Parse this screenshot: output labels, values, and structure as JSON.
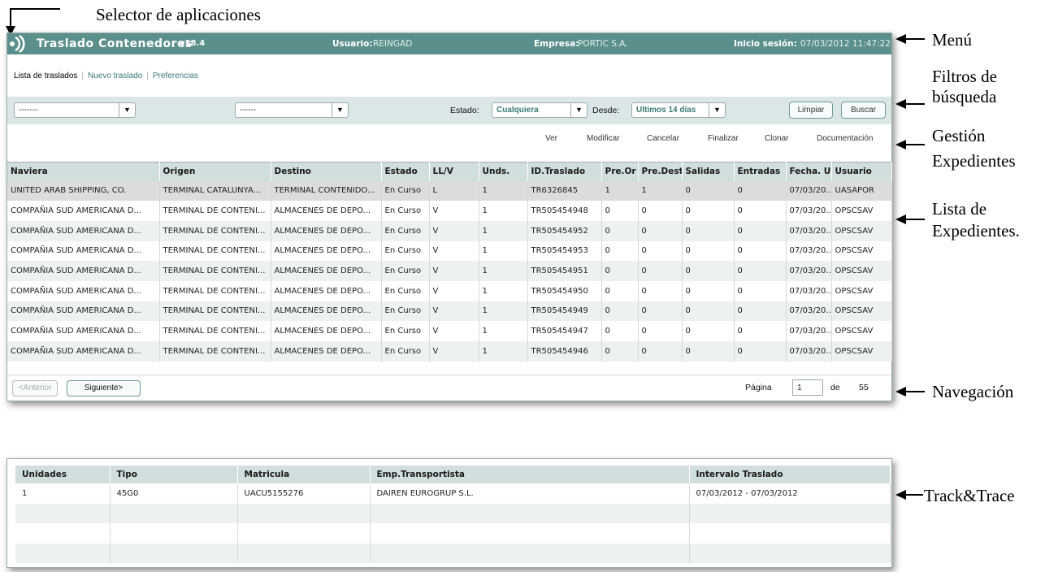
{
  "annotations": {
    "selector": "Selector de aplicaciones",
    "menu": "Menú",
    "filters_1": "Filtros de",
    "filters_2": "búsqueda",
    "gestion_1": "Gestión",
    "gestion_2": "Expedientes",
    "lista_1": "Lista de",
    "lista_2": "Expedientes.",
    "navegacion": "Navegación",
    "track": "Track&Trace"
  },
  "menubar": {
    "app_title": "Traslado Contenedores",
    "version": "v18.4",
    "user_label": "Usuario:",
    "user_value": "REINGAD",
    "company_label": "Empresa:",
    "company_value": "PORTIC S.A.",
    "session_label": "Inicio sesión:",
    "session_value": "07/03/2012 11:47:22"
  },
  "nav_tabs": {
    "list": "Lista de traslados",
    "new": "Nuevo traslado",
    "prefs": "Preferencias"
  },
  "filters": {
    "select1": "-------",
    "select2": "------",
    "estado_label": "Estado:",
    "estado_value": "Cualquiera",
    "desde_label": "Desde:",
    "desde_value": "Últimos 14 días",
    "clear_label": "Limpiar",
    "search_label": "Buscar"
  },
  "actions": {
    "view": "Ver",
    "modify": "Modificar",
    "cancel": "Cancelar",
    "finish": "Finalizar",
    "clone": "Clonar",
    "docs": "Documentación"
  },
  "grid": {
    "columns": [
      "Naviera",
      "Origen",
      "Destino",
      "Estado",
      "LL/V",
      "Unds.",
      "ID.Traslado",
      "Pre.Or",
      "Pre.Dest.",
      "Salidas",
      "Entradas",
      "Fecha. Ul",
      "Usuario"
    ],
    "rows": [
      [
        "UNITED ARAB SHIPPING, CO.",
        "TERMINAL CATALUNYA...",
        "TERMINAL CONTENIDO...",
        "En Curso",
        "L",
        "1",
        "TR6326845",
        "1",
        "1",
        "0",
        "0",
        "07/03/20...",
        "UASAPOR"
      ],
      [
        "COMPAÑIA SUD AMERICANA D...",
        "TERMINAL DE CONTENI...",
        "ALMACENES DE DEPO...",
        "En Curso",
        "V",
        "1",
        "TR505454948",
        "0",
        "0",
        "0",
        "0",
        "07/03/20...",
        "OPSCSAV"
      ],
      [
        "COMPAÑIA SUD AMERICANA D...",
        "TERMINAL DE CONTENI...",
        "ALMACENES DE DEPO...",
        "En Curso",
        "V",
        "1",
        "TR505454952",
        "0",
        "0",
        "0",
        "0",
        "07/03/20...",
        "OPSCSAV"
      ],
      [
        "COMPAÑIA SUD AMERICANA D...",
        "TERMINAL DE CONTENI...",
        "ALMACENES DE DEPO...",
        "En Curso",
        "V",
        "1",
        "TR505454953",
        "0",
        "0",
        "0",
        "0",
        "07/03/20...",
        "OPSCSAV"
      ],
      [
        "COMPAÑIA SUD AMERICANA D...",
        "TERMINAL DE CONTENI...",
        "ALMACENES DE DEPO...",
        "En Curso",
        "V",
        "1",
        "TR505454951",
        "0",
        "0",
        "0",
        "0",
        "07/03/20...",
        "OPSCSAV"
      ],
      [
        "COMPAÑIA SUD AMERICANA D...",
        "TERMINAL DE CONTENI...",
        "ALMACENES DE DEPO...",
        "En Curso",
        "V",
        "1",
        "TR505454950",
        "0",
        "0",
        "0",
        "0",
        "07/03/20...",
        "OPSCSAV"
      ],
      [
        "COMPAÑIA SUD AMERICANA D...",
        "TERMINAL DE CONTENI...",
        "ALMACENES DE DEPO...",
        "En Curso",
        "V",
        "1",
        "TR505454949",
        "0",
        "0",
        "0",
        "0",
        "07/03/20...",
        "OPSCSAV"
      ],
      [
        "COMPAÑIA SUD AMERICANA D...",
        "TERMINAL DE CONTENI...",
        "ALMACENES DE DEPO...",
        "En Curso",
        "V",
        "1",
        "TR505454947",
        "0",
        "0",
        "0",
        "0",
        "07/03/20...",
        "OPSCSAV"
      ],
      [
        "COMPAÑIA SUD AMERICANA D...",
        "TERMINAL DE CONTENI...",
        "ALMACENES DE DEPO...",
        "En Curso",
        "V",
        "1",
        "TR505454946",
        "0",
        "0",
        "0",
        "0",
        "07/03/20...",
        "OPSCSAV"
      ]
    ]
  },
  "pager": {
    "prev": "<Anterior",
    "next": "Siguiente>",
    "page_label": "Página",
    "page_value": "1",
    "of_label": "de",
    "total_pages": "55"
  },
  "track": {
    "columns": [
      "Unidades",
      "Tipo",
      "Matricula",
      "Emp.Transportista",
      "Intervalo Traslado"
    ],
    "rows": [
      [
        "1",
        "45G0",
        "UACU5155276",
        "DAIREN EUROGRUP S.L.",
        "07/03/2012 - 07/03/2012"
      ],
      [
        "",
        "",
        "",
        "",
        ""
      ],
      [
        "",
        "",
        "",
        "",
        ""
      ],
      [
        "",
        "",
        "",
        "",
        ""
      ]
    ]
  },
  "colors": {
    "menubar": "#5b8f8c",
    "header": "#d0dedd",
    "filterbar": "#dbe7e7",
    "accent": "#3a7a74"
  }
}
